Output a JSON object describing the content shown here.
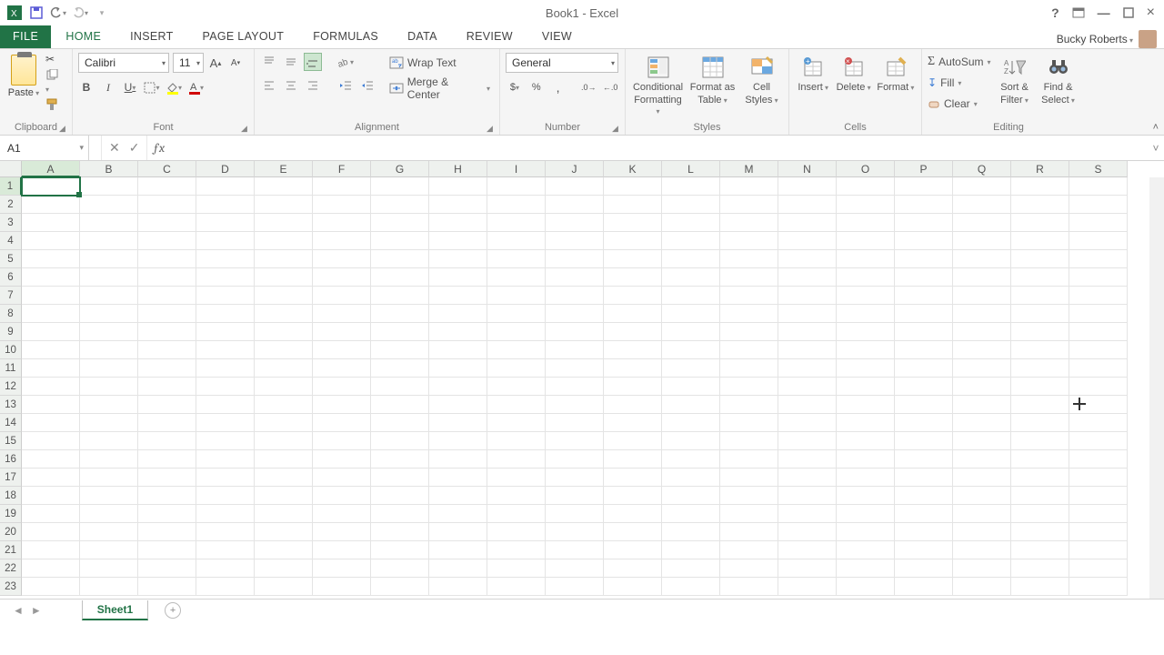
{
  "title": "Book1 - Excel",
  "user": {
    "name": "Bucky Roberts"
  },
  "tabs": {
    "file": "FILE",
    "list": [
      "HOME",
      "INSERT",
      "PAGE LAYOUT",
      "FORMULAS",
      "DATA",
      "REVIEW",
      "VIEW"
    ],
    "active": "HOME"
  },
  "ribbon": {
    "clipboard": {
      "paste": "Paste",
      "label": "Clipboard"
    },
    "font": {
      "name": "Calibri",
      "size": "11",
      "bold": "B",
      "italic": "I",
      "underline": "U",
      "label": "Font"
    },
    "alignment": {
      "wrap": "Wrap Text",
      "merge": "Merge & Center",
      "label": "Alignment"
    },
    "number": {
      "format": "General",
      "label": "Number"
    },
    "styles": {
      "cond": "Conditional Formatting",
      "cond1": "Conditional",
      "cond2": "Formatting",
      "fat1": "Format as",
      "fat2": "Table",
      "cs1": "Cell",
      "cs2": "Styles",
      "label": "Styles"
    },
    "cells": {
      "insert": "Insert",
      "delete": "Delete",
      "format": "Format",
      "label": "Cells"
    },
    "editing": {
      "autosum": "AutoSum",
      "fill": "Fill",
      "clear": "Clear",
      "sort1": "Sort &",
      "sort2": "Filter",
      "find1": "Find &",
      "find2": "Select",
      "label": "Editing"
    }
  },
  "fx": {
    "cell": "A1",
    "formula": ""
  },
  "grid": {
    "cols": [
      "A",
      "B",
      "C",
      "D",
      "E",
      "F",
      "G",
      "H",
      "I",
      "J",
      "K",
      "L",
      "M",
      "N",
      "O",
      "P",
      "Q",
      "R",
      "S"
    ],
    "rows": 23,
    "active": {
      "col": "A",
      "row": 1
    }
  },
  "sheet": {
    "name": "Sheet1"
  }
}
